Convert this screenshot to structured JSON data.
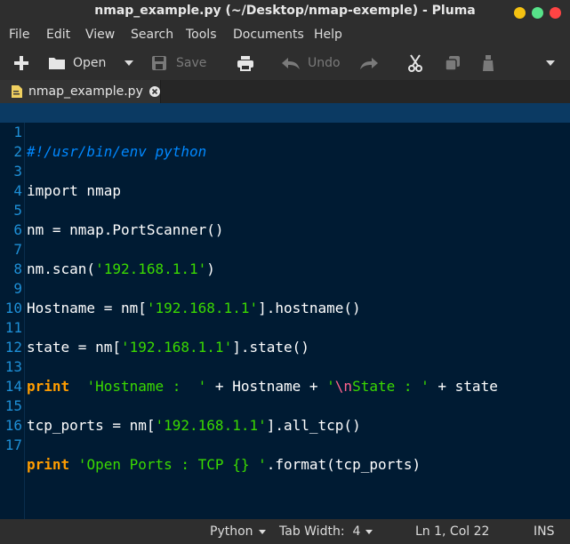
{
  "window": {
    "title": "nmap_example.py (~/Desktop/nmap-exemple) - Pluma",
    "buttons": {
      "minimize_color": "#f5c211",
      "maximize_color": "#57e389",
      "close_color": "#ff4444"
    }
  },
  "menu": [
    "File",
    "Edit",
    "View",
    "Search",
    "Tools",
    "Documents",
    "Help"
  ],
  "toolbar": {
    "new_icon": "plus-icon",
    "open_label": "Open",
    "save_label": "Save",
    "undo_label": "Undo"
  },
  "tab": {
    "label": "nmap_example.py"
  },
  "editor": {
    "lines": [
      "1",
      "2",
      "3",
      "4",
      "5",
      "6",
      "7",
      "8",
      "9",
      "10",
      "11",
      "12",
      "13",
      "14",
      "15",
      "16",
      "17"
    ],
    "code": {
      "l1": "#!/usr/bin/env python",
      "l3": "import nmap",
      "l5": "nm = nmap.PortScanner()",
      "l7a": "nm.scan(",
      "l7s": "'192.168.1.1'",
      "l7b": ")",
      "l9a": "Hostname = nm[",
      "l9s": "'192.168.1.1'",
      "l9b": "].hostname()",
      "l11a": "state = nm[",
      "l11s": "'192.168.1.1'",
      "l11b": "].state()",
      "l13kw": "print",
      "l13s1": "  'Hostname :  '",
      "l13a": " + Hostname + ",
      "l13s2a": "'",
      "l13esc": "\\n",
      "l13s2b": "State : '",
      "l13b": " + state",
      "l15a": "tcp_ports = nm[",
      "l15s": "'192.168.1.1'",
      "l15b": "].all_tcp()",
      "l17kw": "print",
      "l17s": " 'Open Ports : TCP {} '",
      "l17b": ".format(tcp_ports)"
    }
  },
  "status": {
    "language": "Python",
    "tab_width": "Tab Width:  4",
    "position": "Ln 1, Col 22",
    "mode": "INS"
  }
}
